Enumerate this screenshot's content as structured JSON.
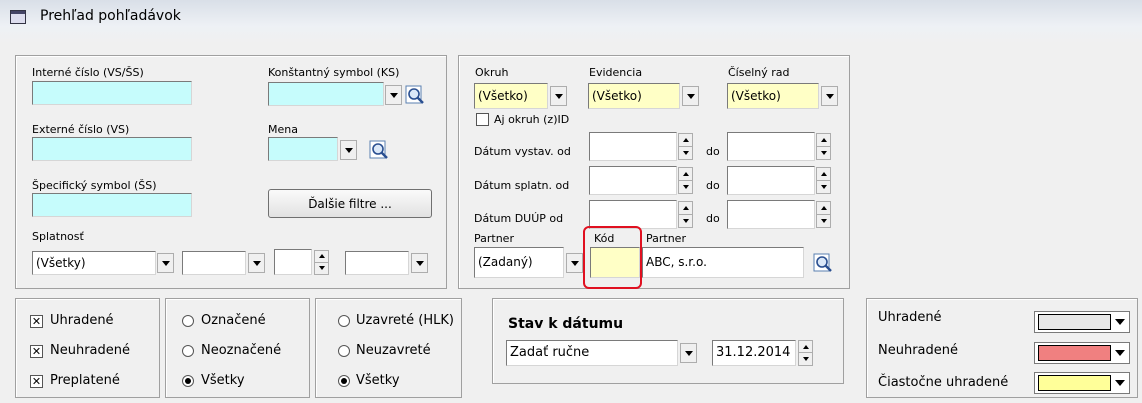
{
  "window": {
    "title": "Prehľad pohľadávok"
  },
  "left_panel": {
    "interne_cislo_label": "Interné číslo (VS/ŠS)",
    "externe_cislo_label": "Externé číslo (VS)",
    "specificky_symbol_label": "Špecifický symbol (ŠS)",
    "splatnost_label": "Splatnosť",
    "splatnost_value": "(Všetky)",
    "konstantny_symbol_label": "Konštantný symbol (KS)",
    "mena_label": "Mena",
    "dalsie_filtre_label": "Ďalšie filtre ..."
  },
  "right_panel": {
    "okruh_label": "Okruh",
    "okruh_value": "(Všetko)",
    "evidencia_label": "Evidencia",
    "evidencia_value": "(Všetko)",
    "ciselny_rad_label": "Číselný rad",
    "ciselny_rad_value": "(Všetko)",
    "aj_okruh_label": "Aj okruh (z)ID",
    "datum_vystav_label": "Dátum vystav. od",
    "datum_splatn_label": "Dátum splatn. od",
    "datum_duup_label": "Dátum DUÚP od",
    "do_label": "do",
    "partner_label": "Partner",
    "partner_type_value": "(Zadaný)",
    "kod_label": "Kód",
    "partner_name_label": "Partner",
    "partner_name_value": "ABC, s.r.o."
  },
  "status_group1": {
    "uhradene": "Uhradené",
    "neuhradene": "Neuhradené",
    "preplatene": "Preplatené"
  },
  "status_group2": {
    "oznacene": "Označené",
    "neoznacene": "Neoznačené",
    "vsetky": "Všetky"
  },
  "status_group3": {
    "uzavrete": "Uzavreté (HLK)",
    "neuzavrete": "Neuzavreté",
    "vsetky": "Všetky"
  },
  "stav_k_datumu": {
    "title": "Stav k dátumu",
    "mode_value": "Zadať ručne",
    "date_value": "31.12.2014"
  },
  "legend": {
    "uhradene_label": "Uhradené",
    "uhradene_color": "#e8e8e8",
    "neuhradene_label": "Neuhradené",
    "neuhradene_color": "#f08080",
    "ciastocne_label": "Čiastočne uhradené",
    "ciastocne_color": "#ffff99"
  }
}
